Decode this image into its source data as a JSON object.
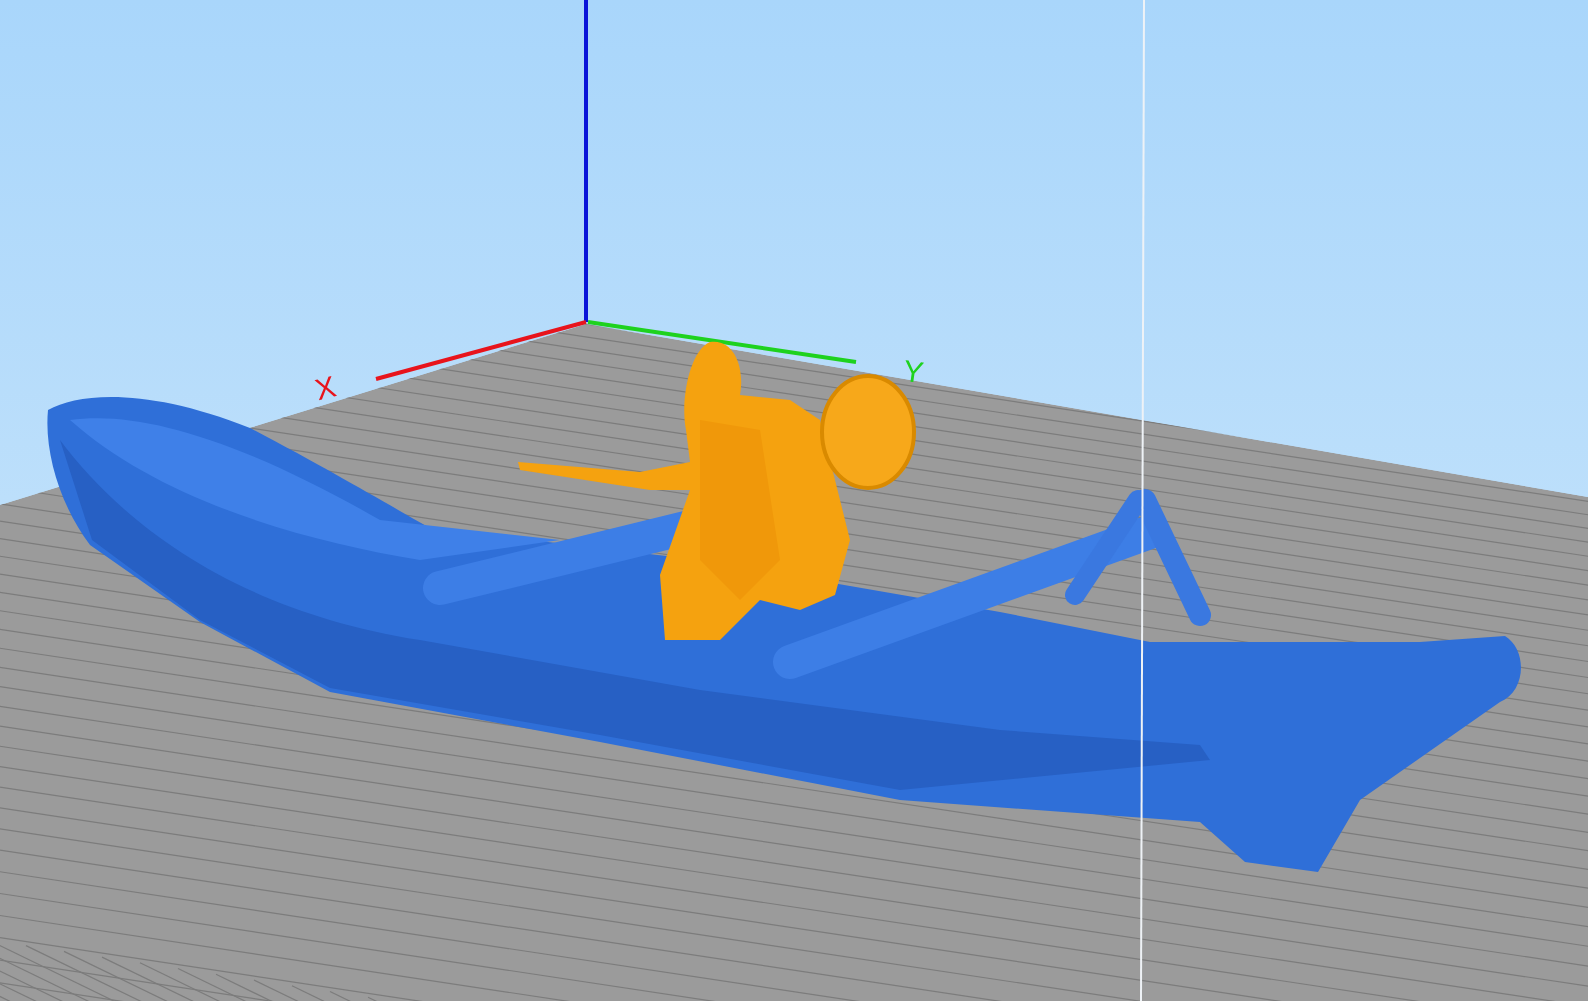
{
  "viewport": {
    "axes": [
      {
        "label": "X",
        "color": "#e8141c"
      },
      {
        "label": "Y",
        "color": "#1ed21e"
      }
    ]
  }
}
